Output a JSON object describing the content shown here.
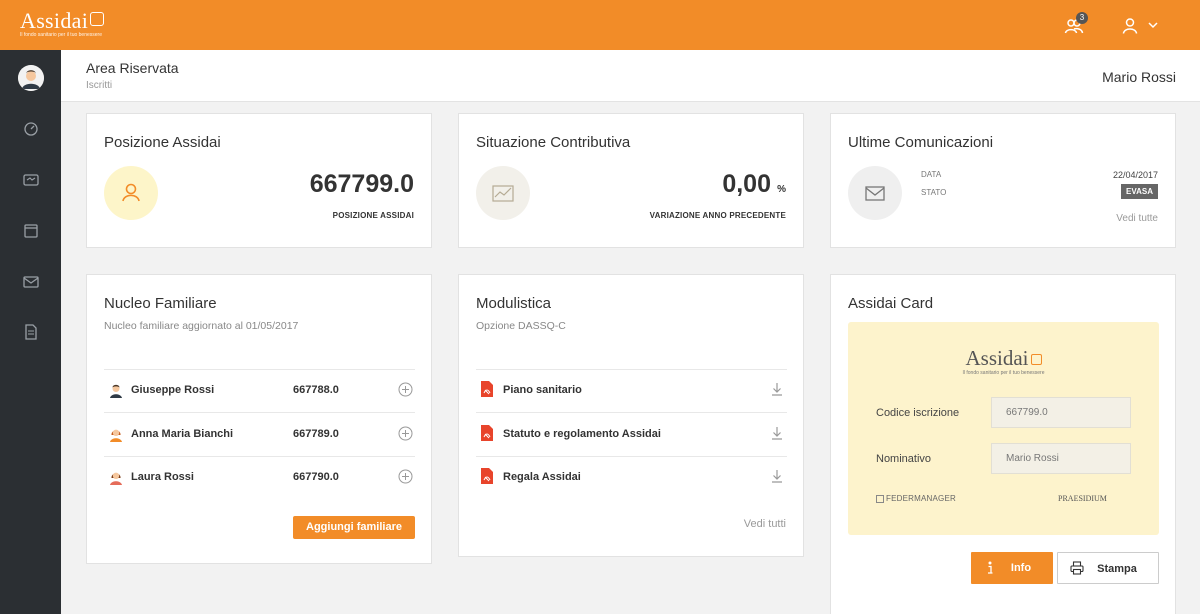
{
  "brand": {
    "logo_text": "Assidai",
    "logo_tagline": "Il fondo sanitario per il tuo benessere"
  },
  "topbar": {
    "notifications_count": "3"
  },
  "header": {
    "title": "Area Riservata",
    "subtitle": "Iscritti",
    "user_name": "Mario Rossi"
  },
  "posizione": {
    "title": "Posizione Assidai",
    "value": "667799.0",
    "label": "POSIZIONE ASSIDAI"
  },
  "situazione": {
    "title": "Situazione Contributiva",
    "value": "0,00",
    "unit": "%",
    "label": "VARIAZIONE ANNO PRECEDENTE"
  },
  "comunicazioni": {
    "title": "Ultime Comunicazioni",
    "date_label": "DATA",
    "date_value": "22/04/2017",
    "status_label": "STATO",
    "status_value": "EVASA",
    "link": "Vedi tutte"
  },
  "nucleo": {
    "title": "Nucleo Familiare",
    "subtitle": "Nucleo familiare aggiornato al 01/05/2017",
    "members": [
      {
        "name": "Giuseppe Rossi",
        "code": "667788.0"
      },
      {
        "name": "Anna Maria Bianchi",
        "code": "667789.0"
      },
      {
        "name": "Laura Rossi",
        "code": "667790.0"
      }
    ],
    "add_button": "Aggiungi familiare"
  },
  "modulistica": {
    "title": "Modulistica",
    "subtitle": "Opzione DASSQ-C",
    "docs": [
      {
        "name": "Piano sanitario"
      },
      {
        "name": "Statuto e regolamento Assidai"
      },
      {
        "name": "Regala Assidai"
      }
    ],
    "link": "Vedi tutti"
  },
  "card": {
    "title": "Assidai Card",
    "logo_text": "Assidai",
    "logo_tagline": "Il fondo sanitario per il tuo benessere",
    "code_label": "Codice iscrizione",
    "code_value": "667799.0",
    "name_label": "Nominativo",
    "name_value": "Mario Rossi",
    "partner1": "FEDERMANAGER",
    "partner2": "PRAESIDIUM",
    "info_button": "Info",
    "print_button": "Stampa"
  },
  "colors": {
    "accent": "#f28c28",
    "sidebar": "#2b2f33",
    "card_bg": "#fdf3cc"
  }
}
